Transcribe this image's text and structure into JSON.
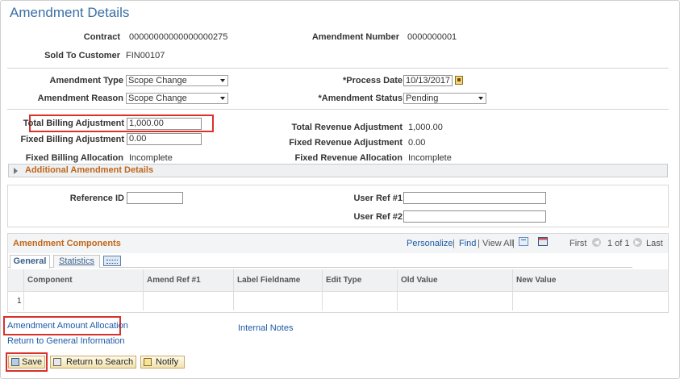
{
  "page_title": "Amendment Details",
  "fields": {
    "contract_label": "Contract",
    "contract_value": "00000000000000000275",
    "amendment_number_label": "Amendment Number",
    "amendment_number_value": "0000000001",
    "sold_to_label": "Sold To Customer",
    "sold_to_value": "FIN00107",
    "amendment_type_label": "Amendment Type",
    "amendment_type_value": "Scope Change",
    "process_date_label": "*Process Date",
    "process_date_value": "10/13/2017",
    "amendment_reason_label": "Amendment Reason",
    "amendment_reason_value": "Scope Change",
    "amendment_status_label": "*Amendment Status",
    "amendment_status_value": "Pending",
    "total_billing_label": "Total Billing Adjustment",
    "total_billing_value": "1,000.00",
    "fixed_billing_label": "Fixed Billing Adjustment",
    "fixed_billing_value": "0.00",
    "total_revenue_label": "Total Revenue Adjustment",
    "total_revenue_value": "1,000.00",
    "fixed_revenue_label": "Fixed Revenue Adjustment",
    "fixed_revenue_value": "0.00",
    "fixed_billing_alloc_label": "Fixed Billing Allocation",
    "fixed_billing_alloc_value": "Incomplete",
    "fixed_revenue_alloc_label": "Fixed Revenue Allocation",
    "fixed_revenue_alloc_value": "Incomplete"
  },
  "additional_section": "Additional Amendment Details",
  "references": {
    "reference_id_label": "Reference ID",
    "reference_id_value": "",
    "user_ref1_label": "User Ref #1",
    "user_ref1_value": "",
    "user_ref2_label": "User Ref #2",
    "user_ref2_value": ""
  },
  "grid": {
    "title": "Amendment Components",
    "personalize": "Personalize",
    "sep1": "|",
    "find": "Find",
    "sep2": "|",
    "view_all": "View All",
    "sep3": "|",
    "first": "First",
    "range": "1 of 1",
    "last": "Last",
    "tabs": [
      "General",
      "Statistics"
    ],
    "columns": [
      "Component",
      "Amend Ref #1",
      "Label Fieldname",
      "Edit Type",
      "Old Value",
      "New Value"
    ],
    "rows": [
      [
        "1",
        "",
        "",
        "",
        "",
        "",
        ""
      ]
    ]
  },
  "links": {
    "amendment_allocation": "Amendment Amount Allocation",
    "internal_notes": "Internal Notes",
    "return_general": "Return to General Information"
  },
  "buttons": {
    "save": "Save",
    "return_search": "Return to Search",
    "notify": "Notify"
  },
  "colors": {
    "title_blue": "#3b6fa4",
    "section_orange": "#c0671b",
    "link_blue": "#1d5aa8",
    "highlight_red": "#d9312c"
  },
  "icons": [
    "calendar-icon",
    "dropdown-arrow-icon",
    "expand-triangle-icon",
    "zoom-grid-icon",
    "download-excel-icon",
    "previous-icon",
    "next-icon",
    "show-all-columns-icon",
    "save-icon",
    "return-icon",
    "notify-icon"
  ]
}
